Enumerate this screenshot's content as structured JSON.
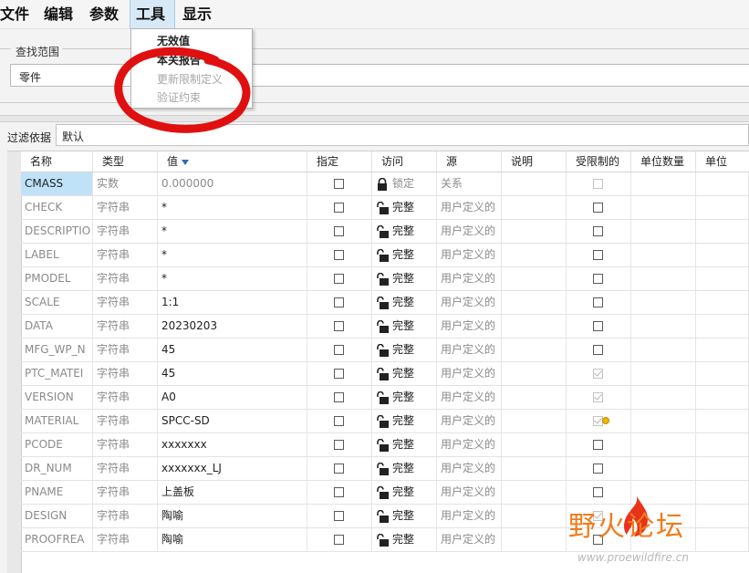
{
  "menubar": {
    "items": [
      {
        "label": "文件"
      },
      {
        "label": "编辑"
      },
      {
        "label": "参数"
      },
      {
        "label": "工具"
      },
      {
        "label": "显示"
      }
    ]
  },
  "tools_menu": {
    "items": [
      {
        "label": "无效值",
        "enabled": true
      },
      {
        "label": "本关报告",
        "enabled": true
      },
      {
        "label": "更新限制定义",
        "enabled": false
      },
      {
        "label": "验证约束",
        "enabled": false
      }
    ]
  },
  "search_range": {
    "label": "查找范围",
    "value": "零件"
  },
  "filter": {
    "label": "过滤依据",
    "value": "默认"
  },
  "columns": [
    "名称",
    "类型",
    "值",
    "指定",
    "访问",
    "源",
    "说明",
    "受限制的",
    "单位数量",
    "单位"
  ],
  "rows": [
    {
      "name": "CMASS",
      "type": "实数",
      "value": "0.000000",
      "assigned": false,
      "access": "锁定",
      "source": "关系",
      "desc": "",
      "restricted": "disabled",
      "selected": true
    },
    {
      "name": "CHECK",
      "type": "字符串",
      "value": "*",
      "assigned": false,
      "access": "完整",
      "source": "用户定义的",
      "desc": "",
      "restricted": "empty"
    },
    {
      "name": "DESCRIPTIO",
      "type": "字符串",
      "value": "*",
      "assigned": false,
      "access": "完整",
      "source": "用户定义的",
      "desc": "",
      "restricted": "empty"
    },
    {
      "name": "LABEL",
      "type": "字符串",
      "value": "*",
      "assigned": false,
      "access": "完整",
      "source": "用户定义的",
      "desc": "",
      "restricted": "empty"
    },
    {
      "name": "PMODEL",
      "type": "字符串",
      "value": "*",
      "assigned": false,
      "access": "完整",
      "source": "用户定义的",
      "desc": "",
      "restricted": "empty"
    },
    {
      "name": "SCALE",
      "type": "字符串",
      "value": "1:1",
      "assigned": false,
      "access": "完整",
      "source": "用户定义的",
      "desc": "",
      "restricted": "empty"
    },
    {
      "name": "DATA",
      "type": "字符串",
      "value": "20230203",
      "assigned": false,
      "access": "完整",
      "source": "用户定义的",
      "desc": "",
      "restricted": "empty"
    },
    {
      "name": "MFG_WP_N",
      "type": "字符串",
      "value": "45",
      "assigned": false,
      "access": "完整",
      "source": "用户定义的",
      "desc": "",
      "restricted": "empty"
    },
    {
      "name": "PTC_MATEI",
      "type": "字符串",
      "value": "45",
      "assigned": false,
      "access": "完整",
      "source": "用户定义的",
      "desc": "",
      "restricted": "checked"
    },
    {
      "name": "VERSION",
      "type": "字符串",
      "value": "A0",
      "assigned": false,
      "access": "完整",
      "source": "用户定义的",
      "desc": "",
      "restricted": "checked"
    },
    {
      "name": "MATERIAL",
      "type": "字符串",
      "value": "SPCC-SD",
      "assigned": false,
      "access": "完整",
      "source": "用户定义的",
      "desc": "",
      "restricted": "checked-dot"
    },
    {
      "name": "PCODE",
      "type": "字符串",
      "value": "xxxxxxx",
      "assigned": false,
      "access": "完整",
      "source": "用户定义的",
      "desc": "",
      "restricted": "empty"
    },
    {
      "name": "DR_NUM",
      "type": "字符串",
      "value": "xxxxxxx_LJ",
      "assigned": false,
      "access": "完整",
      "source": "用户定义的",
      "desc": "",
      "restricted": "empty"
    },
    {
      "name": "PNAME",
      "type": "字符串",
      "value": "上盖板",
      "assigned": false,
      "access": "完整",
      "source": "用户定义的",
      "desc": "",
      "restricted": "empty"
    },
    {
      "name": "DESIGN",
      "type": "字符串",
      "value": "陶喻",
      "assigned": false,
      "access": "完整",
      "source": "用户定义的",
      "desc": "",
      "restricted": "checked"
    },
    {
      "name": "PROOFREA",
      "type": "字符串",
      "value": "陶喻",
      "assigned": false,
      "access": "完整",
      "source": "用户定义的",
      "desc": "",
      "restricted": "empty"
    }
  ],
  "watermark": {
    "title": "野火论坛",
    "url": "www.proewildfire.cn"
  },
  "colors": {
    "selection": "#bfe2f8",
    "annotation": "#e01010",
    "watermark": "#f07c1c"
  }
}
